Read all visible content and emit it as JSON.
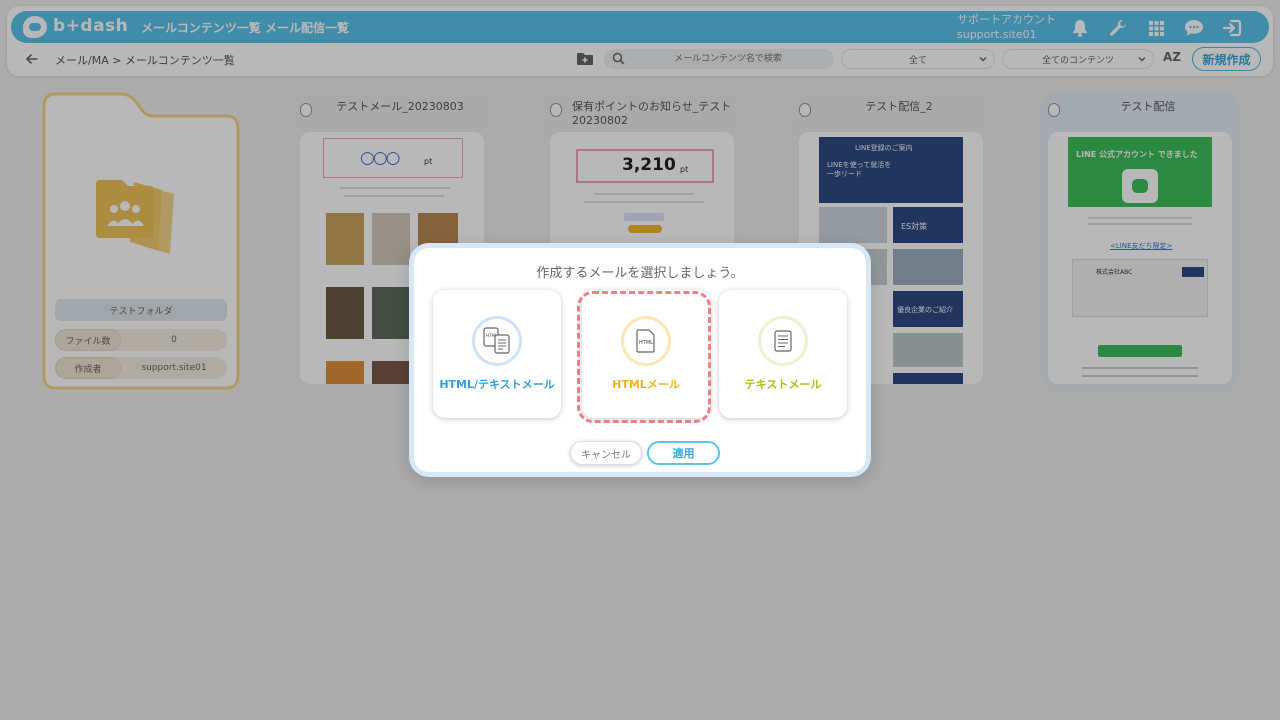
{
  "app": {
    "logo_text": "b+dash"
  },
  "nav": {
    "items": [
      "メールコンテンツ一覧",
      "メール配信一覧"
    ]
  },
  "account": {
    "name": "サポートアカウント",
    "id": "support.site01"
  },
  "breadcrumb": "メール/MA > メールコンテンツ一覧",
  "search": {
    "placeholder": "メールコンテンツ名で検索"
  },
  "filters": {
    "filter1": "全て",
    "filter2": "全てのコンテンツ"
  },
  "sort_label": "AZ",
  "new_button": "新規作成",
  "folder": {
    "name": "テストフォルダ",
    "file_count_label": "ファイル数",
    "file_count": "0",
    "creator_label": "作成者",
    "creator": "support.site01"
  },
  "cards": [
    {
      "title": "テストメール_20230803",
      "preview_headline": "○○○",
      "preview_unit": "pt"
    },
    {
      "title": "保有ポイントのお知らせ_テスト20230802",
      "preview_headline": "3,210",
      "preview_unit": "pt"
    },
    {
      "title": "テスト配信_2",
      "preview_headline": "LINE登録のご案内",
      "preview_sub": "LINEを使って就活を一歩リード",
      "preview_tags": [
        "ES対策",
        "優良企業のご紹介"
      ]
    },
    {
      "title": "テスト配信",
      "preview_headline": "LINE 公式アカウント できました",
      "preview_sub": "<LINE友だち限定>",
      "preview_company": "株式会社ABC"
    }
  ],
  "modal": {
    "title": "作成するメールを選択しましょう。",
    "options": [
      {
        "label": "HTML/テキストメール",
        "color": "#2f9fe0"
      },
      {
        "label": "HTMLメール",
        "color": "#f2b51b"
      },
      {
        "label": "テキストメール",
        "color": "#a7c21a"
      }
    ],
    "cancel": "キャンセル",
    "apply": "適用"
  }
}
